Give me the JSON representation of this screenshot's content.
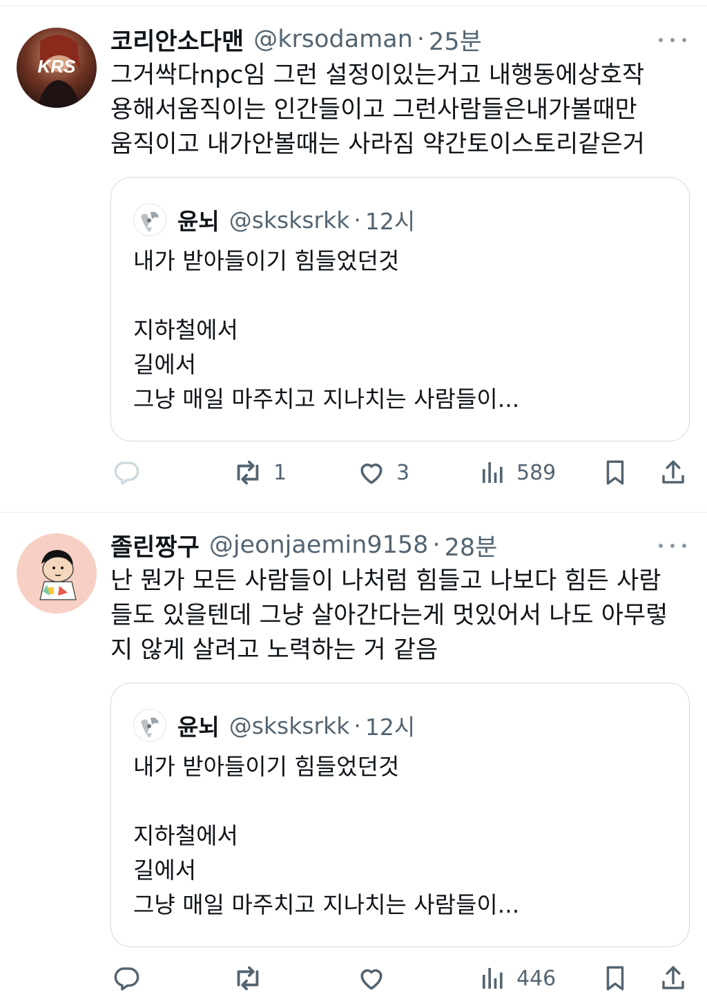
{
  "tweets": [
    {
      "author_name": "코리안소다맨",
      "handle": "@krsodaman",
      "separator": "·",
      "time": "25분",
      "avatar_label": "KRS",
      "text": "그거싹다npc임 그런 설정이있는거고 내행동에상호작\n용해서움직이는 인간들이고 그런사람들은내가볼때만\n움직이고 내가안볼때는 사라짐 약간토이스토리같은거",
      "quote": {
        "author_name": "윤뇌",
        "handle": "@sksksrkk",
        "separator": "·",
        "time": "12시",
        "text": "내가 받아들이기 힘들었던것\n\n지하철에서\n길에서\n그냥 매일 마주치고 지나치는 사람들이..."
      },
      "actions": {
        "retweets": "1",
        "likes": "3",
        "views": "589"
      }
    },
    {
      "author_name": "졸린짱구",
      "handle": "@jeonjaemin9158",
      "separator": "·",
      "time": "28분",
      "text": "난 뭔가 모든 사람들이 나처럼 힘들고 나보다 힘든 사람\n들도 있을텐데 그냥 살아간다는게 멋있어서 나도 아무렇\n지 않게 살려고 노력하는 거 같음",
      "quote": {
        "author_name": "윤뇌",
        "handle": "@sksksrkk",
        "separator": "·",
        "time": "12시",
        "text": "내가 받아들이기 힘들었던것\n\n지하철에서\n길에서\n그냥 매일 마주치고 지나치는 사람들이..."
      },
      "actions": {
        "views": "446"
      }
    }
  ],
  "icons": [
    "reply-icon",
    "retweet-icon",
    "like-icon",
    "views-icon",
    "bookmark-icon",
    "share-icon",
    "more-icon"
  ],
  "colors": {
    "text": "#0f1419",
    "secondary": "#536471",
    "border": "#cfd9de",
    "reply_inactive": "#cfd9de"
  }
}
